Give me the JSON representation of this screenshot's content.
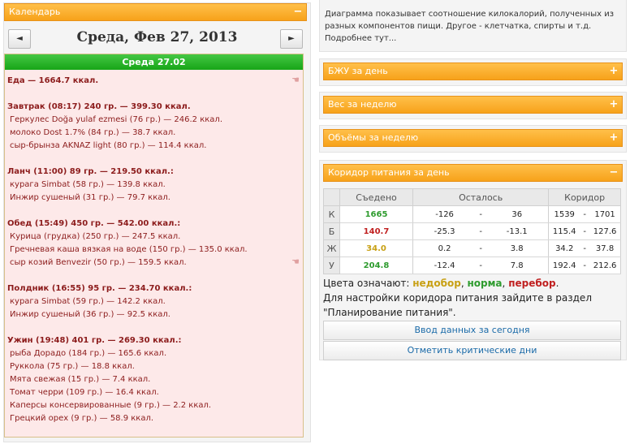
{
  "calendar": {
    "title": "Календарь",
    "date_title": "Среда, Фев 27, 2013",
    "prev_label": "◄",
    "next_label": "►",
    "day_header": "Среда 27.02",
    "food_total": "Еда — 1664.7 ккал.",
    "meals": [
      {
        "head": "Завтрак (08:17) 240 гр. — 399.30 ккал.",
        "items": [
          "Геркулес Doğa yulaf ezmesi (76 гр.) — 246.2 ккал.",
          "молоко Dost 1.7% (84 гр.) — 38.7 ккал.",
          "сыр-брынза AKNAZ light (80 гр.) — 114.4 ккал."
        ]
      },
      {
        "head": "Ланч (11:00) 89 гр. — 219.50 ккал.:",
        "items": [
          "курага Simbat (58 гр.) — 139.8 ккал.",
          "Инжир сушеный (31 гр.) — 79.7 ккал."
        ]
      },
      {
        "head": "Обед (15:49) 450 гр. — 542.00 ккал.:",
        "items": [
          "Курица (грудка) (250 гр.) — 247.5 ккал.",
          "Гречневая каша вязкая на воде (150 гр.) — 135.0 ккал.",
          "сыр козий Benvezir (50 гр.) — 159.5 ккал."
        ]
      },
      {
        "head": "Полдник (16:55) 95 гр. — 234.70 ккал.:",
        "items": [
          "курага Simbat (59 гр.) — 142.2 ккал.",
          "Инжир сушеный (36 гр.) — 92.5 ккал."
        ]
      },
      {
        "head": "Ужин (19:48) 401 гр. — 269.30 ккал.:",
        "items": [
          "рыба Дорадо (184 гр.) — 165.6 ккал.",
          "Руккола (75 гр.) — 18.8 ккал.",
          "Мята свежая (15 гр.) — 7.4 ккал.",
          "Томат черри (109 гр.) — 16.4 ккал.",
          "Каперсы консервированные (9 гр.) — 2.2 ккал.",
          "Грецкий орех (9 гр.) — 58.9 ккал."
        ]
      }
    ]
  },
  "info": {
    "text": "Диаграмма показывает соотношение килокалорий, полученных из разных компонентов пищи. Другое - клетчатка, спирты и т.д. Подробнее тут..."
  },
  "panels": {
    "bju": "БЖУ за день",
    "weight": "Вес за неделю",
    "volumes": "Объёмы за неделю",
    "corridor": "Коридор питания за день"
  },
  "corridor_table": {
    "headers": [
      "",
      "Съедено",
      "Осталось",
      "Коридор"
    ],
    "rows": [
      {
        "key": "К",
        "eaten": "1665",
        "eaten_color": "#2e9b2e",
        "rem_a": "-126",
        "rem_b": "36",
        "cor_a": "1539",
        "cor_b": "1701"
      },
      {
        "key": "Б",
        "eaten": "140.7",
        "eaten_color": "#c02020",
        "rem_a": "-25.3",
        "rem_b": "-13.1",
        "cor_a": "115.4",
        "cor_b": "127.6"
      },
      {
        "key": "Ж",
        "eaten": "34.0",
        "eaten_color": "#c8a014",
        "rem_a": "0.2",
        "rem_b": "3.8",
        "cor_a": "34.2",
        "cor_b": "37.8"
      },
      {
        "key": "У",
        "eaten": "204.8",
        "eaten_color": "#2e9b2e",
        "rem_a": "-12.4",
        "rem_b": "7.8",
        "cor_a": "192.4",
        "cor_b": "212.6"
      }
    ],
    "dash": "-"
  },
  "legend": {
    "prefix": "Цвета означают:",
    "under": "недобор",
    "norm": "норма",
    "over": "перебор",
    "sep1": ",",
    "sep2": ",",
    "end": "."
  },
  "plan_text": "Для настройки коридора питания зайдите в раздел \"Планирование питания\".",
  "buttons": {
    "enter_data": "Ввод данных за сегодня",
    "mark_critical": "Отметить критические дни"
  }
}
